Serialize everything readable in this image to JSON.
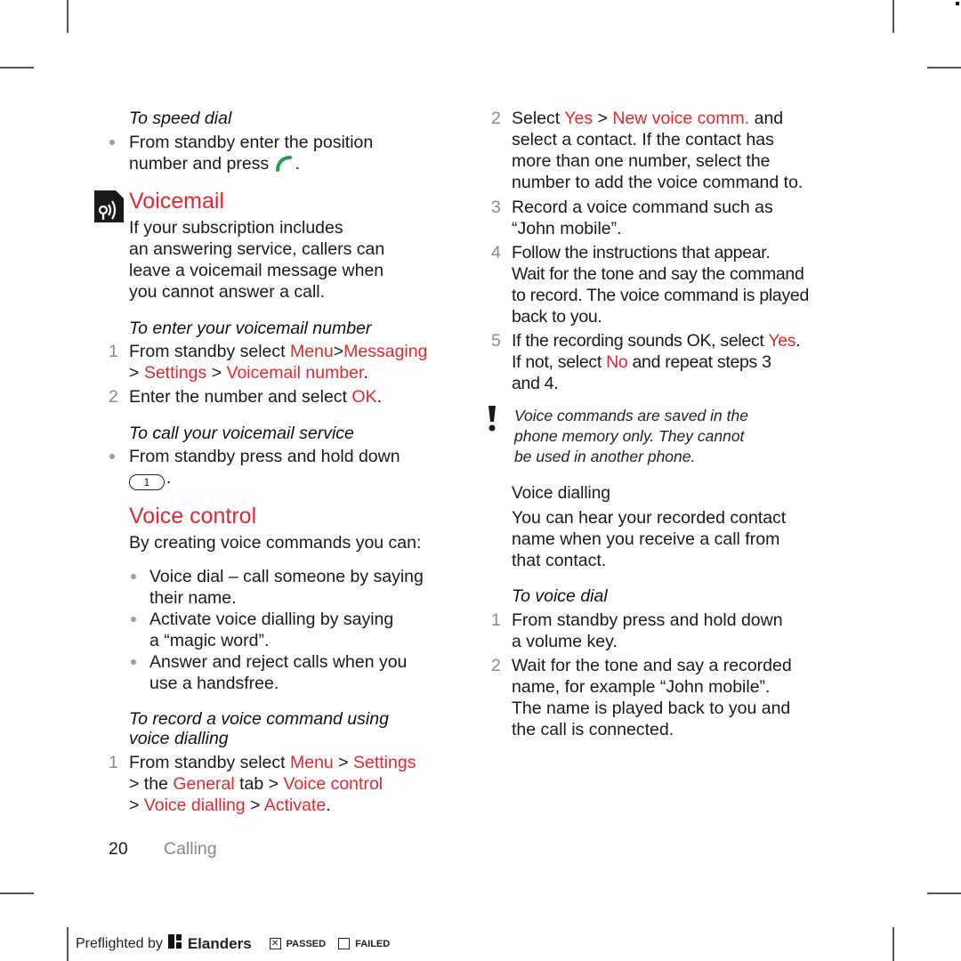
{
  "left": {
    "speed_dial": {
      "heading": "To speed dial",
      "bullet_line1": "From standby enter the position",
      "bullet_line2": "number and press",
      "call_icon": "call-key-icon"
    },
    "voicemail": {
      "title": "Voicemail",
      "icon": "voicemail-operator-service-icon",
      "intro": [
        "If your subscription includes",
        "an answering service, callers can",
        "leave a voicemail message when",
        "you cannot answer a call."
      ]
    },
    "enter_number": {
      "heading": "To enter your voicemail number",
      "step1": {
        "n": "1",
        "pre": "From standby select ",
        "menu": "Menu",
        "sep1": ">",
        "messaging": "Messaging",
        "sep2": "> ",
        "settings": "Settings",
        "sep3": " > ",
        "vm_number": "Voicemail number",
        "end": "."
      },
      "step2": {
        "n": "2",
        "pre": "Enter the number and select ",
        "ok": "OK",
        "end": "."
      }
    },
    "call_service": {
      "heading": "To call your voicemail service",
      "bullet": "From standby press and hold down",
      "key_label": "1",
      "end": "."
    },
    "voice_control": {
      "title": "Voice control",
      "intro": "By creating voice commands you can:",
      "bullets": [
        [
          "Voice dial – call someone by saying",
          "their name."
        ],
        [
          "Activate voice dialling by saying",
          "a “magic word”."
        ],
        [
          "Answer and reject calls when you",
          "use a handsfree."
        ]
      ]
    },
    "record": {
      "heading_line1": "To record a voice command using",
      "heading_line2": "voice dialling",
      "step1": {
        "n": "1",
        "pre": "From standby select ",
        "menu": "Menu",
        "sep1": " > ",
        "settings": "Settings",
        "l2_pre": "> the ",
        "general": "General",
        "l2_mid": " tab > ",
        "voice_control": "Voice control",
        "l3_pre": "> ",
        "voice_dialling": "Voice dialling",
        "l3_mid": " > ",
        "activate": "Activate",
        "end": "."
      }
    }
  },
  "right": {
    "steps": [
      {
        "n": "2",
        "lines": [
          "select a contact. If the contact has",
          "more than one number, select the",
          "number to add the voice command to."
        ],
        "pre": "Select ",
        "yes": "Yes",
        "sep": " > ",
        "new_cmd": "New voice comm.",
        "post": " and"
      },
      {
        "n": "3",
        "lines": [
          "Record a voice command such as",
          "“John mobile”."
        ]
      },
      {
        "n": "4",
        "lines": [
          "Follow the instructions that appear.",
          "Wait for the tone and say the command",
          "to record. The voice command is played",
          "back to you."
        ]
      },
      {
        "n": "5",
        "pre": "If the recording sounds OK, select ",
        "yes": "Yes",
        "end": ".",
        "l2_pre": "If not, select ",
        "no": "No",
        "l2_post": " and repeat steps 3",
        "l3": "and 4."
      }
    ],
    "note": {
      "icon": "exclamation-icon",
      "lines": [
        "Voice commands are saved in the",
        "phone memory only. They cannot",
        "be used in another phone."
      ]
    },
    "voice_dialling": {
      "heading": "Voice dialling",
      "body": [
        "You can hear your recorded contact",
        "name when you receive a call from",
        "that contact."
      ]
    },
    "voice_dial": {
      "heading": "To voice dial",
      "steps": [
        {
          "n": "1",
          "lines": [
            "From standby press and hold down",
            "a volume key."
          ]
        },
        {
          "n": "2",
          "lines": [
            "Wait for the tone and say a recorded",
            "name, for example “John mobile”.",
            "The name is played back to you and",
            "the call is connected."
          ]
        }
      ]
    }
  },
  "footer": {
    "page_number": "20",
    "section": "Calling"
  },
  "preflight": {
    "label": "Preflighted by",
    "brand": "Elanders",
    "passed": "PASSED",
    "failed": "FAILED",
    "passed_checked": true,
    "failed_checked": false
  },
  "colors": {
    "accent": "#e3262f",
    "call_green": "#1fa04a"
  }
}
